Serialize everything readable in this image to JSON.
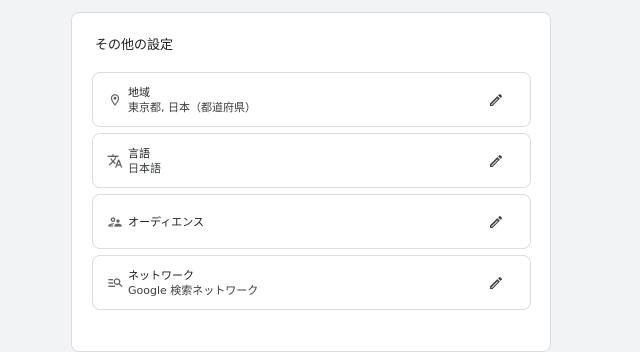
{
  "section": {
    "title": "その他の設定"
  },
  "settings": [
    {
      "icon": "location-pin-icon",
      "label": "地域",
      "value": "東京都, 日本（都道府県）"
    },
    {
      "icon": "translate-icon",
      "label": "言語",
      "value": "日本語"
    },
    {
      "icon": "audience-people-icon",
      "label": "オーディエンス",
      "value": ""
    },
    {
      "icon": "network-search-icon",
      "label": "ネットワーク",
      "value": "Google 検索ネットワーク"
    }
  ],
  "colors": {
    "background": "#f1f3f4",
    "card": "#ffffff",
    "border": "#dadce0",
    "text": "#202124",
    "icon": "#5f6368"
  }
}
